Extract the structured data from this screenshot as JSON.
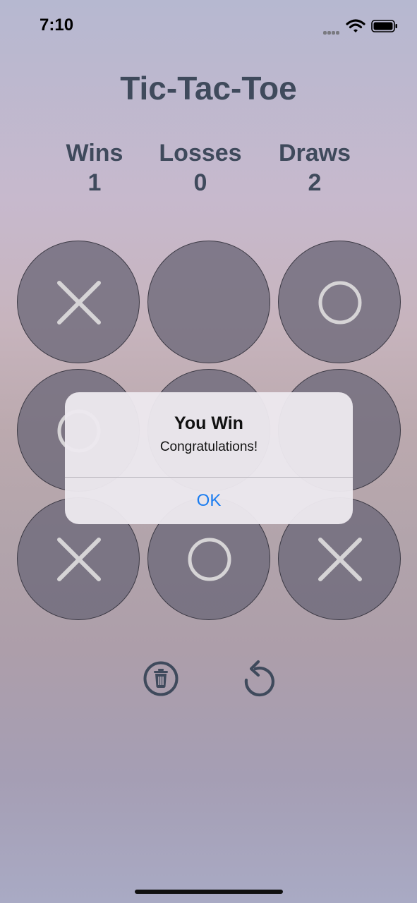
{
  "status_bar": {
    "time": "7:10"
  },
  "title": "Tic-Tac-Toe",
  "scores": [
    {
      "label": "Wins",
      "value": "1"
    },
    {
      "label": "Losses",
      "value": "0"
    },
    {
      "label": "Draws",
      "value": "2"
    }
  ],
  "board": [
    [
      "X",
      "",
      "O"
    ],
    [
      "O",
      "",
      ""
    ],
    [
      "X",
      "O",
      "X"
    ]
  ],
  "controls": {
    "reset_scores_icon": "trash-icon",
    "restart_icon": "restart-arrow-icon"
  },
  "alert": {
    "title": "You Win",
    "message": "Congratulations!",
    "ok_label": "OK"
  },
  "colors": {
    "text": "#3f4a5c",
    "cell": "#6c6878",
    "mark": "#d6d4d6",
    "accent": "#1a7cf0"
  }
}
